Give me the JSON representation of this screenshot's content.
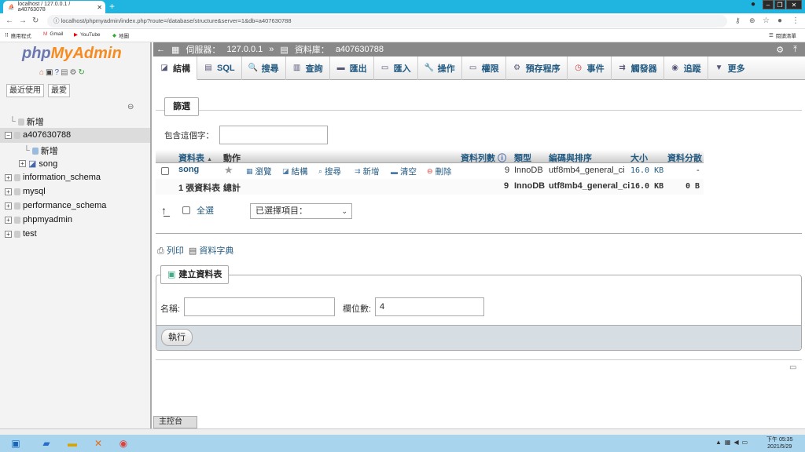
{
  "browser": {
    "tab_title": "localhost / 127.0.0.1 / a40763078",
    "url": "localhost/phpmyadmin/index.php?route=/database/structure&server=1&db=a407630788",
    "bookmarks": [
      "應用程式",
      "Gmail",
      "YouTube",
      "地圖"
    ],
    "reading_list": "閱讀清單"
  },
  "pma": {
    "logo_php": "php",
    "logo_myadmin": "MyAdmin",
    "recent": "最近使用",
    "favorites": "最愛",
    "tree": [
      {
        "label": "新增",
        "level": 0
      },
      {
        "label": "a407630788",
        "level": 0
      },
      {
        "label": "新增",
        "level": 1
      },
      {
        "label": "song",
        "level": 1
      },
      {
        "label": "information_schema",
        "level": 0
      },
      {
        "label": "mysql",
        "level": 0
      },
      {
        "label": "performance_schema",
        "level": 0
      },
      {
        "label": "phpmyadmin",
        "level": 0
      },
      {
        "label": "test",
        "level": 0
      }
    ],
    "breadcrumb": {
      "server_label": "伺服器：",
      "server": "127.0.0.1",
      "sep": "»",
      "db_label": "資料庫：",
      "db": "a407630788"
    },
    "tabs": [
      "結構",
      "SQL",
      "搜尋",
      "查詢",
      "匯出",
      "匯入",
      "操作",
      "權限",
      "預存程序",
      "事件",
      "觸發器",
      "追蹤",
      "更多"
    ],
    "filter": {
      "legend": "篩選",
      "label": "包含這個字："
    },
    "table": {
      "headers": [
        "資料表",
        "動作",
        "資料列數",
        "類型",
        "編碼與排序",
        "大小",
        "資料分散"
      ],
      "rows": [
        {
          "name": "song",
          "actions": [
            "瀏覽",
            "結構",
            "搜尋",
            "新增",
            "清空",
            "刪除"
          ],
          "rows": "9",
          "type": "InnoDB",
          "collation": "utf8mb4_general_ci",
          "size": "16.0 KB",
          "overhead": "-"
        }
      ],
      "summary": {
        "name": "1 張資料表",
        "label": "總計",
        "rows": "9",
        "type": "InnoDB",
        "collation": "utf8mb4_general_ci",
        "size": "16.0 KB",
        "overhead": "0 B"
      },
      "check_all": "全選",
      "with_selected": "已選擇項目："
    },
    "print": "列印",
    "dictionary": "資料字典",
    "create": {
      "legend": "建立資料表",
      "name_label": "名稱:",
      "name_value": "",
      "columns_label": "欄位數:",
      "columns_value": "4",
      "go": "執行"
    },
    "console": "主控台"
  },
  "taskbar": {
    "time": "下午 05:35",
    "date": "2021/5/29"
  }
}
